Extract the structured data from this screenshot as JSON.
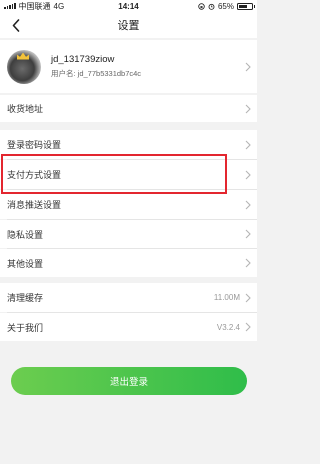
{
  "status_bar": {
    "carrier": "中国联通",
    "network": "4G",
    "time": "14:14",
    "battery_text": "65%",
    "battery_level": 0.65
  },
  "nav": {
    "title": "设置",
    "back_icon": "chevron-left-icon"
  },
  "profile": {
    "username": "jd_131739ziow",
    "user_label": "用户名: jd_77b5331db7c4c"
  },
  "settings": {
    "address": "收货地址",
    "login_password": "登录密码设置",
    "payment": "支付方式设置",
    "notifications": "消息推送设置",
    "privacy": "隐私设置",
    "other": "其他设置",
    "clear_cache": "清理缓存",
    "cache_size": "11.00M",
    "about": "关于我们",
    "version": "V3.2.4"
  },
  "logout_label": "退出登录",
  "colors": {
    "accent_green": "#2fbd4a",
    "highlight_red": "#e3262f"
  }
}
